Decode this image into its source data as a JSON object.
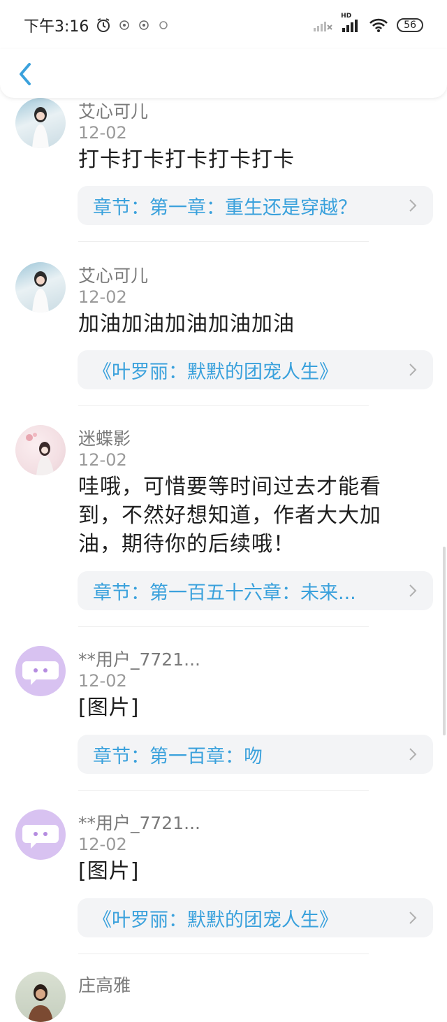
{
  "status_bar": {
    "time": "下午3:16",
    "signal_label": "HD",
    "battery": "56"
  },
  "colors": {
    "accent": "#3aa1dc",
    "chapter_bg": "#f3f4f6",
    "purple_avatar": "#d8c2f1"
  },
  "comments": [
    {
      "username": "艾心可儿",
      "date": "12-02",
      "text": "打卡打卡打卡打卡打卡",
      "link": "章节：第一章：重生还是穿越？",
      "avatar": "girl-photo"
    },
    {
      "username": "艾心可儿",
      "date": "12-02",
      "text": "加油加油加油加油加油",
      "link": "《叶罗丽：默默的团宠人生》",
      "avatar": "girl-photo"
    },
    {
      "username": "迷蝶影",
      "date": "12-02",
      "text": "哇哦，可惜要等时间过去才能看到，不然好想知道，作者大大加油，期待你的后续哦！",
      "link": "章节：第一百五十六章：未来...",
      "avatar": "ink-painting"
    },
    {
      "username": "**用户_7721...",
      "date": "12-02",
      "text": "[图片]",
      "link": "章节：第一百章：吻",
      "avatar": "default-chat-icon"
    },
    {
      "username": "**用户_7721...",
      "date": "12-02",
      "text": "[图片]",
      "link": "《叶罗丽：默默的团宠人生》",
      "avatar": "default-chat-icon"
    },
    {
      "username": "庄高雅",
      "avatar": "person-photo"
    }
  ]
}
